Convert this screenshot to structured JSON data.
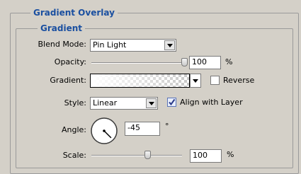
{
  "panel": {
    "title": "Gradient Overlay",
    "section_title": "Gradient"
  },
  "blend_mode": {
    "label": "Blend Mode:",
    "value": "Pin Light"
  },
  "opacity": {
    "label": "Opacity:",
    "value": "100",
    "unit": "%",
    "slider_fraction": 1.0
  },
  "gradient": {
    "label": "Gradient:",
    "preview": "transparent-to-white-gradient"
  },
  "reverse": {
    "label": "Reverse",
    "checked": false
  },
  "style": {
    "label": "Style:",
    "value": "Linear"
  },
  "align_with_layer": {
    "label": "Align with Layer",
    "checked": true
  },
  "angle": {
    "label": "Angle:",
    "value": "-45",
    "unit": "°",
    "degrees": -45
  },
  "scale": {
    "label": "Scale:",
    "value": "100",
    "unit": "%",
    "slider_fraction": 0.5
  },
  "colors": {
    "accent_blue": "#1a4fa0",
    "dialog_bg": "#d4d0c8"
  }
}
